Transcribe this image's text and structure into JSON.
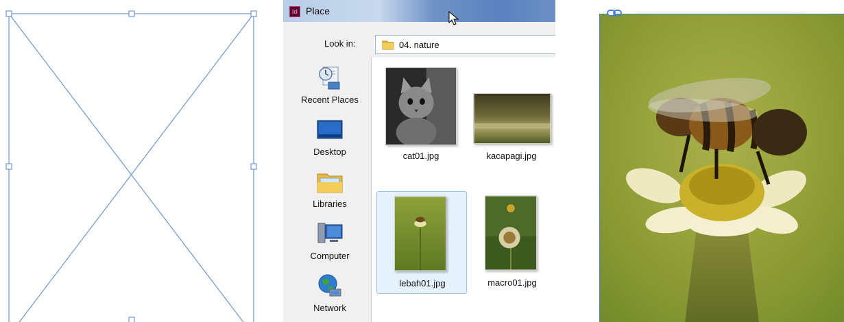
{
  "dialog": {
    "title": "Place",
    "app_icon_text": "Id",
    "look_in_label": "Look in:",
    "look_in_value": "04. nature"
  },
  "places": [
    {
      "label": "Recent Places",
      "icon": "recent-places-icon"
    },
    {
      "label": "Desktop",
      "icon": "desktop-icon"
    },
    {
      "label": "Libraries",
      "icon": "libraries-icon"
    },
    {
      "label": "Computer",
      "icon": "computer-icon"
    },
    {
      "label": "Network",
      "icon": "network-icon"
    }
  ],
  "files": [
    {
      "name": "cat01.jpg",
      "selected": false
    },
    {
      "name": "kacapagi.jpg",
      "selected": false
    },
    {
      "name": "lebah01.jpg",
      "selected": true
    },
    {
      "name": "macro01.jpg",
      "selected": false
    }
  ],
  "colors": {
    "frame_stroke": "#6f95d0",
    "selection_fill": "#e5f1fb",
    "selection_border": "#9cc5ea",
    "titlebar_blue": "#5a82bf"
  }
}
